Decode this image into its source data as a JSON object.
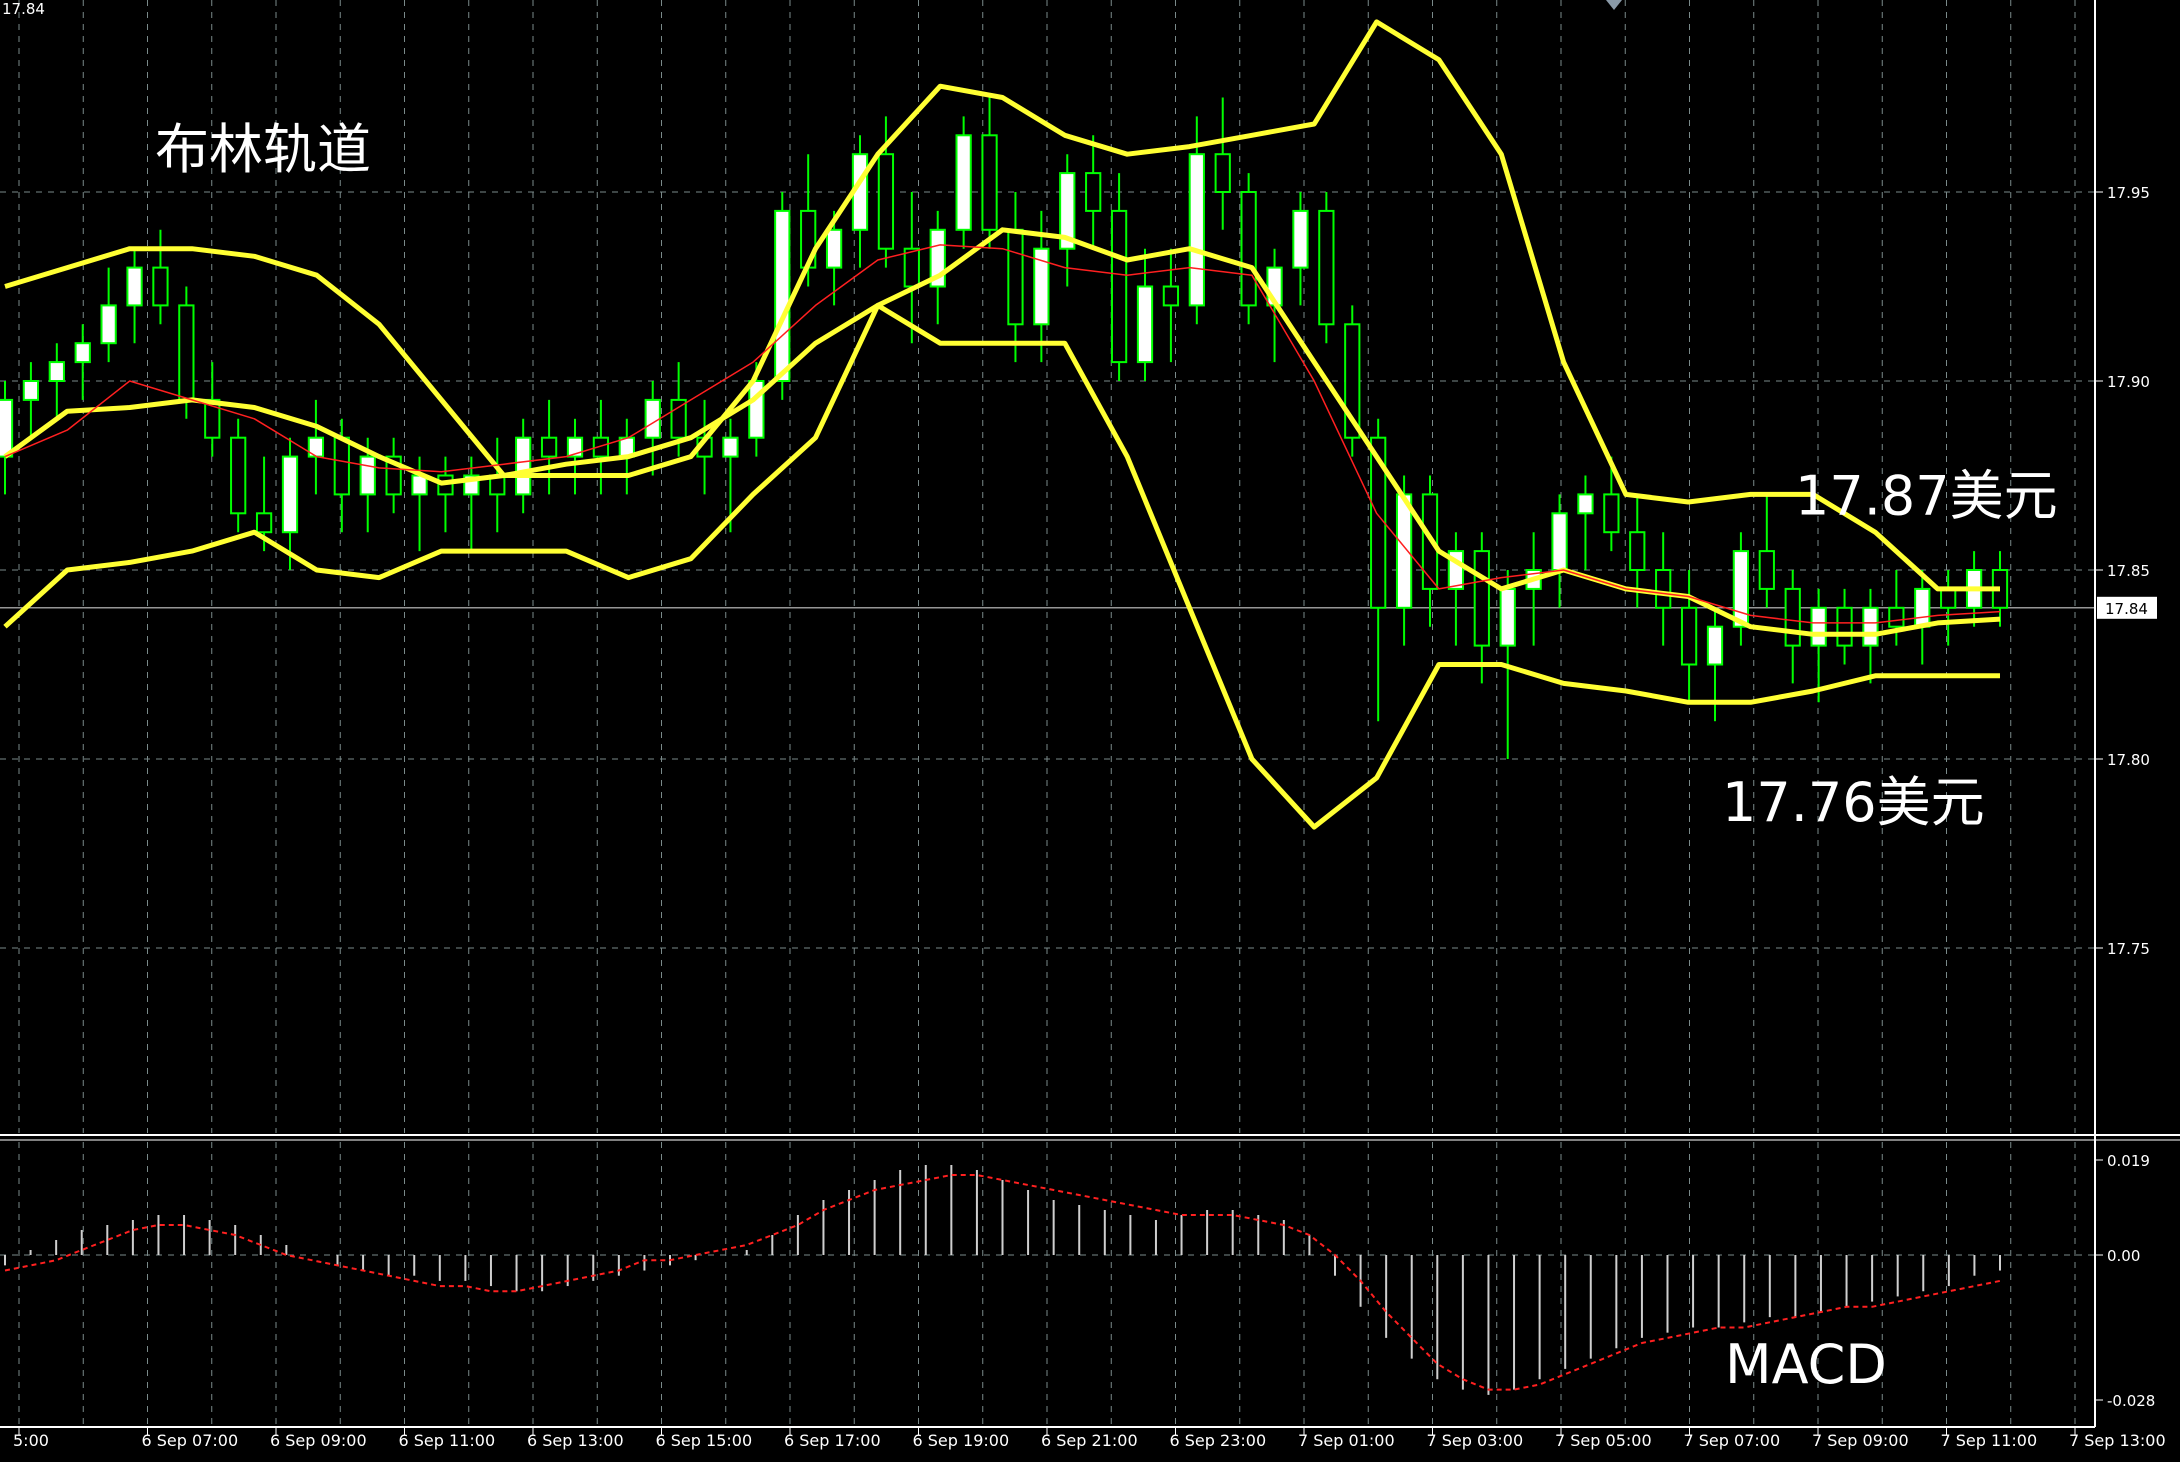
{
  "chart_data": [
    {
      "type": "candlestick",
      "title": "布林轨道",
      "ylim": [
        17.7,
        17.99
      ],
      "y_ticks": [
        "17.95",
        "17.90",
        "17.85",
        "17.80",
        "17.75"
      ],
      "top_left_price": "17.84",
      "current_price": 17.84,
      "current_price_label": "17.84",
      "x_labels": [
        "5:00",
        "6 Sep 07:00",
        "6 Sep 09:00",
        "6 Sep 11:00",
        "6 Sep 13:00",
        "6 Sep 15:00",
        "6 Sep 17:00",
        "6 Sep 19:00",
        "6 Sep 21:00",
        "6 Sep 23:00",
        "7 Sep 01:00",
        "7 Sep 03:00",
        "7 Sep 05:00",
        "7 Sep 07:00",
        "7 Sep 09:00",
        "7 Sep 11:00",
        "7 Sep 13:00"
      ],
      "annotations": [
        {
          "text": "17.87美元",
          "price": 17.87
        },
        {
          "text": "17.76美元",
          "price": 17.8
        }
      ],
      "bollinger_upper": [
        17.925,
        17.93,
        17.935,
        17.935,
        17.933,
        17.928,
        17.915,
        17.895,
        17.875,
        17.875,
        17.875,
        17.88,
        17.9,
        17.935,
        17.96,
        17.978,
        17.975,
        17.965,
        17.96,
        17.962,
        17.965,
        17.968,
        17.995,
        17.985,
        17.96,
        17.905,
        17.87,
        17.868,
        17.87,
        17.87,
        17.86,
        17.845,
        17.845
      ],
      "bollinger_middle": [
        17.88,
        17.892,
        17.893,
        17.895,
        17.893,
        17.888,
        17.88,
        17.873,
        17.875,
        17.878,
        17.88,
        17.885,
        17.895,
        17.91,
        17.92,
        17.928,
        17.94,
        17.938,
        17.932,
        17.935,
        17.93,
        17.905,
        17.88,
        17.855,
        17.845,
        17.85,
        17.845,
        17.843,
        17.835,
        17.833,
        17.833,
        17.836,
        17.837
      ],
      "bollinger_lower": [
        17.835,
        17.85,
        17.852,
        17.855,
        17.86,
        17.85,
        17.848,
        17.855,
        17.855,
        17.855,
        17.848,
        17.853,
        17.87,
        17.885,
        17.92,
        17.91,
        17.91,
        17.91,
        17.88,
        17.84,
        17.8,
        17.782,
        17.795,
        17.825,
        17.825,
        17.82,
        17.818,
        17.815,
        17.815,
        17.818,
        17.822,
        17.822,
        17.822
      ],
      "ma": [
        17.88,
        17.887,
        17.9,
        17.895,
        17.89,
        17.88,
        17.877,
        17.876,
        17.878,
        17.88,
        17.885,
        17.895,
        17.905,
        17.92,
        17.932,
        17.936,
        17.935,
        17.93,
        17.928,
        17.93,
        17.928,
        17.9,
        17.865,
        17.845,
        17.848,
        17.85,
        17.845,
        17.843,
        17.838,
        17.836,
        17.836,
        17.838,
        17.839
      ],
      "candles": [
        [
          17.88,
          17.9,
          17.87,
          17.895
        ],
        [
          17.895,
          17.905,
          17.885,
          17.9
        ],
        [
          17.9,
          17.91,
          17.89,
          17.905
        ],
        [
          17.905,
          17.915,
          17.895,
          17.91
        ],
        [
          17.91,
          17.93,
          17.905,
          17.92
        ],
        [
          17.92,
          17.935,
          17.91,
          17.93
        ],
        [
          17.93,
          17.94,
          17.915,
          17.92
        ],
        [
          17.92,
          17.925,
          17.89,
          17.895
        ],
        [
          17.895,
          17.905,
          17.88,
          17.885
        ],
        [
          17.885,
          17.89,
          17.86,
          17.865
        ],
        [
          17.865,
          17.88,
          17.855,
          17.86
        ],
        [
          17.86,
          17.885,
          17.85,
          17.88
        ],
        [
          17.88,
          17.895,
          17.87,
          17.885
        ],
        [
          17.885,
          17.89,
          17.86,
          17.87
        ],
        [
          17.87,
          17.885,
          17.86,
          17.88
        ],
        [
          17.88,
          17.885,
          17.865,
          17.87
        ],
        [
          17.87,
          17.88,
          17.855,
          17.875
        ],
        [
          17.875,
          17.88,
          17.86,
          17.87
        ],
        [
          17.87,
          17.88,
          17.855,
          17.875
        ],
        [
          17.875,
          17.885,
          17.86,
          17.87
        ],
        [
          17.87,
          17.89,
          17.865,
          17.885
        ],
        [
          17.885,
          17.895,
          17.87,
          17.88
        ],
        [
          17.88,
          17.89,
          17.87,
          17.885
        ],
        [
          17.885,
          17.895,
          17.87,
          17.88
        ],
        [
          17.88,
          17.89,
          17.87,
          17.885
        ],
        [
          17.885,
          17.9,
          17.875,
          17.895
        ],
        [
          17.895,
          17.905,
          17.88,
          17.885
        ],
        [
          17.885,
          17.895,
          17.87,
          17.88
        ],
        [
          17.88,
          17.89,
          17.86,
          17.885
        ],
        [
          17.885,
          17.905,
          17.88,
          17.9
        ],
        [
          17.9,
          17.95,
          17.895,
          17.945
        ],
        [
          17.945,
          17.96,
          17.925,
          17.93
        ],
        [
          17.93,
          17.945,
          17.92,
          17.94
        ],
        [
          17.94,
          17.965,
          17.93,
          17.96
        ],
        [
          17.96,
          17.97,
          17.93,
          17.935
        ],
        [
          17.935,
          17.95,
          17.91,
          17.925
        ],
        [
          17.925,
          17.945,
          17.915,
          17.94
        ],
        [
          17.94,
          17.97,
          17.935,
          17.965
        ],
        [
          17.965,
          17.975,
          17.935,
          17.94
        ],
        [
          17.94,
          17.95,
          17.905,
          17.915
        ],
        [
          17.915,
          17.945,
          17.905,
          17.935
        ],
        [
          17.935,
          17.96,
          17.925,
          17.955
        ],
        [
          17.955,
          17.965,
          17.935,
          17.945
        ],
        [
          17.945,
          17.955,
          17.9,
          17.905
        ],
        [
          17.905,
          17.935,
          17.9,
          17.925
        ],
        [
          17.925,
          17.935,
          17.905,
          17.92
        ],
        [
          17.92,
          17.97,
          17.915,
          17.96
        ],
        [
          17.96,
          17.975,
          17.94,
          17.95
        ],
        [
          17.95,
          17.955,
          17.915,
          17.92
        ],
        [
          17.92,
          17.935,
          17.905,
          17.93
        ],
        [
          17.93,
          17.95,
          17.92,
          17.945
        ],
        [
          17.945,
          17.95,
          17.91,
          17.915
        ],
        [
          17.915,
          17.92,
          17.88,
          17.885
        ],
        [
          17.885,
          17.89,
          17.81,
          17.84
        ],
        [
          17.84,
          17.875,
          17.83,
          17.87
        ],
        [
          17.87,
          17.875,
          17.835,
          17.845
        ],
        [
          17.845,
          17.86,
          17.83,
          17.855
        ],
        [
          17.855,
          17.86,
          17.82,
          17.83
        ],
        [
          17.83,
          17.85,
          17.8,
          17.845
        ],
        [
          17.845,
          17.86,
          17.83,
          17.85
        ],
        [
          17.85,
          17.87,
          17.84,
          17.865
        ],
        [
          17.865,
          17.875,
          17.85,
          17.87
        ],
        [
          17.87,
          17.88,
          17.855,
          17.86
        ],
        [
          17.86,
          17.87,
          17.84,
          17.85
        ],
        [
          17.85,
          17.86,
          17.83,
          17.84
        ],
        [
          17.84,
          17.85,
          17.815,
          17.825
        ],
        [
          17.825,
          17.84,
          17.81,
          17.835
        ],
        [
          17.835,
          17.86,
          17.83,
          17.855
        ],
        [
          17.855,
          17.87,
          17.84,
          17.845
        ],
        [
          17.845,
          17.85,
          17.82,
          17.83
        ],
        [
          17.83,
          17.845,
          17.815,
          17.84
        ],
        [
          17.84,
          17.845,
          17.825,
          17.83
        ],
        [
          17.83,
          17.845,
          17.82,
          17.84
        ],
        [
          17.84,
          17.85,
          17.83,
          17.835
        ],
        [
          17.835,
          17.85,
          17.825,
          17.845
        ],
        [
          17.845,
          17.85,
          17.83,
          17.84
        ],
        [
          17.84,
          17.855,
          17.835,
          17.85
        ],
        [
          17.85,
          17.855,
          17.835,
          17.84
        ]
      ]
    },
    {
      "type": "bar",
      "title": "MACD",
      "ylim": [
        -0.028,
        0.019
      ],
      "y_ticks": [
        "0.019",
        "0.00",
        "-0.028"
      ],
      "histogram": [
        -0.002,
        0.001,
        0.003,
        0.005,
        0.006,
        0.007,
        0.008,
        0.008,
        0.007,
        0.006,
        0.004,
        0.002,
        0.0,
        -0.002,
        -0.003,
        -0.004,
        -0.004,
        -0.005,
        -0.005,
        -0.006,
        -0.007,
        -0.007,
        -0.006,
        -0.005,
        -0.004,
        -0.003,
        -0.002,
        -0.001,
        0.0,
        0.001,
        0.004,
        0.008,
        0.011,
        0.013,
        0.015,
        0.017,
        0.018,
        0.018,
        0.017,
        0.015,
        0.013,
        0.011,
        0.01,
        0.009,
        0.008,
        0.007,
        0.008,
        0.009,
        0.009,
        0.008,
        0.007,
        0.004,
        -0.004,
        -0.01,
        -0.016,
        -0.02,
        -0.024,
        -0.026,
        -0.027,
        -0.026,
        -0.024,
        -0.022,
        -0.02,
        -0.018,
        -0.016,
        -0.015,
        -0.014,
        -0.014,
        -0.013,
        -0.012,
        -0.012,
        -0.011,
        -0.01,
        -0.009,
        -0.008,
        -0.007,
        -0.006,
        -0.004,
        -0.003
      ],
      "signal": [
        -0.003,
        -0.002,
        -0.001,
        0.001,
        0.003,
        0.005,
        0.006,
        0.006,
        0.005,
        0.004,
        0.002,
        0.0,
        -0.001,
        -0.002,
        -0.003,
        -0.004,
        -0.005,
        -0.006,
        -0.006,
        -0.007,
        -0.007,
        -0.006,
        -0.005,
        -0.004,
        -0.003,
        -0.001,
        -0.001,
        0.0,
        0.001,
        0.002,
        0.004,
        0.006,
        0.009,
        0.011,
        0.013,
        0.014,
        0.015,
        0.016,
        0.016,
        0.015,
        0.014,
        0.013,
        0.012,
        0.011,
        0.01,
        0.009,
        0.008,
        0.008,
        0.008,
        0.007,
        0.006,
        0.004,
        0.0,
        -0.005,
        -0.011,
        -0.016,
        -0.021,
        -0.024,
        -0.026,
        -0.026,
        -0.025,
        -0.023,
        -0.021,
        -0.019,
        -0.017,
        -0.016,
        -0.015,
        -0.014,
        -0.014,
        -0.013,
        -0.012,
        -0.011,
        -0.01,
        -0.01,
        -0.009,
        -0.008,
        -0.007,
        -0.006,
        -0.005
      ]
    }
  ],
  "colors": {
    "background": "#000000",
    "grid": "#7a8a8a",
    "candle_up": "#ffffff",
    "candle_down": "#000000",
    "candle_outline": "#00ff00",
    "bollinger": "#ffff33",
    "ma": "#ff2020",
    "macd_hist": "#cfcfcf",
    "macd_signal": "#ff2020",
    "price_line": "#c8c8c8"
  }
}
